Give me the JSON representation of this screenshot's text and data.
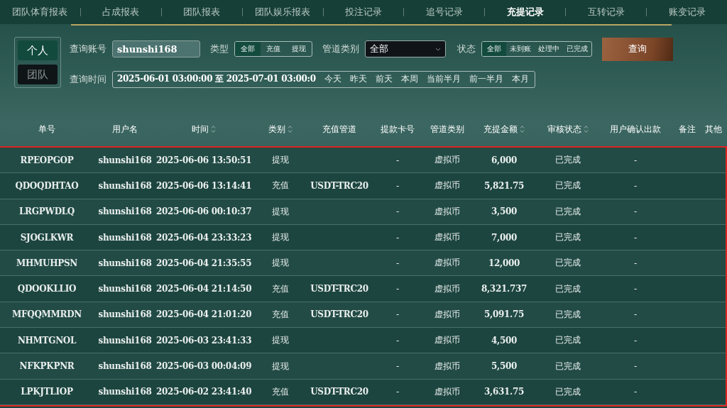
{
  "tabs": [
    {
      "label": "团队体育报表",
      "selected": false
    },
    {
      "label": "占成报表",
      "selected": false
    },
    {
      "label": "团队报表",
      "selected": false
    },
    {
      "label": "团队娱乐报表",
      "selected": false
    },
    {
      "label": "投注记录",
      "selected": false
    },
    {
      "label": "追号记录",
      "selected": false
    },
    {
      "label": "充提记录",
      "selected": true
    },
    {
      "label": "互转记录",
      "selected": false
    },
    {
      "label": "账变记录",
      "selected": false
    }
  ],
  "scope": [
    {
      "label": "个人",
      "selected": true
    },
    {
      "label": "团队",
      "selected": false
    }
  ],
  "filters": {
    "account_label": "查询账号",
    "account_value": "shunshi168",
    "type_label": "类型",
    "types": [
      {
        "label": "全部",
        "selected": true
      },
      {
        "label": "充值",
        "selected": false
      },
      {
        "label": "提现",
        "selected": false
      }
    ],
    "channel_label": "管道类别",
    "channel_value": "全部",
    "status_label": "状态",
    "statuses": [
      {
        "label": "全部",
        "selected": true
      },
      {
        "label": "未到账",
        "selected": false
      },
      {
        "label": "处理中",
        "selected": false
      },
      {
        "label": "已完成",
        "selected": false
      }
    ],
    "search_button": "查询",
    "time_label": "查询时间",
    "time_value": "2025-06-01 03:00:00 至 2025-07-01 03:00:0",
    "quick_dates": [
      "今天",
      "昨天",
      "前天",
      "本周",
      "当前半月",
      "前一半月",
      "本月"
    ]
  },
  "table": {
    "columns": [
      {
        "label": "单号",
        "sortable": false
      },
      {
        "label": "用户名",
        "sortable": false
      },
      {
        "label": "时间",
        "sortable": true
      },
      {
        "label": "类别",
        "sortable": true
      },
      {
        "label": "充值管道",
        "sortable": false
      },
      {
        "label": "提款卡号",
        "sortable": false
      },
      {
        "label": "管道类别",
        "sortable": false
      },
      {
        "label": "充提金额",
        "sortable": true
      },
      {
        "label": "审核状态",
        "sortable": true
      },
      {
        "label": "用户确认出款",
        "sortable": false
      },
      {
        "label": "备注",
        "sortable": false
      },
      {
        "label": "其他",
        "sortable": false
      }
    ],
    "rows": [
      {
        "cells": [
          "RPEOPGOP",
          "shunshi168",
          "2025-06-06 13:50:51",
          "提现",
          null,
          "-",
          "虚拟币",
          "6,000",
          "已完成",
          "-",
          null,
          null
        ]
      },
      {
        "cells": [
          "QDOQDHTAO",
          "shunshi168",
          "2025-06-06 13:14:41",
          "充值",
          "USDT-TRC20",
          "-",
          "虚拟币",
          "5,821.75",
          "已完成",
          "-",
          null,
          null
        ]
      },
      {
        "cells": [
          "LRGPWDLQ",
          "shunshi168",
          "2025-06-06 00:10:37",
          "提现",
          null,
          "-",
          "虚拟币",
          "3,500",
          "已完成",
          "-",
          null,
          null
        ]
      },
      {
        "cells": [
          "SJOGLKWR",
          "shunshi168",
          "2025-06-04 23:33:23",
          "提现",
          null,
          "-",
          "虚拟币",
          "7,000",
          "已完成",
          "-",
          null,
          null
        ]
      },
      {
        "cells": [
          "MHMUHPSN",
          "shunshi168",
          "2025-06-04 21:35:55",
          "提现",
          null,
          "-",
          "虚拟币",
          "12,000",
          "已完成",
          "-",
          null,
          null
        ]
      },
      {
        "cells": [
          "QDOOKLLIO",
          "shunshi168",
          "2025-06-04 21:14:50",
          "充值",
          "USDT-TRC20",
          "-",
          "虚拟币",
          "8,321.737",
          "已完成",
          "-",
          null,
          null
        ]
      },
      {
        "cells": [
          "MFQQMMRDN",
          "shunshi168",
          "2025-06-04 21:01:20",
          "充值",
          "USDT-TRC20",
          "-",
          "虚拟币",
          "5,091.75",
          "已完成",
          "-",
          null,
          null
        ]
      },
      {
        "cells": [
          "NHMTGNOL",
          "shunshi168",
          "2025-06-03 23:41:33",
          "提现",
          null,
          "-",
          "虚拟币",
          "4,500",
          "已完成",
          "-",
          null,
          null
        ]
      },
      {
        "cells": [
          "NFKPKPNR",
          "shunshi168",
          "2025-06-03 00:04:09",
          "提现",
          null,
          "-",
          "虚拟币",
          "5,500",
          "已完成",
          "-",
          null,
          null
        ]
      },
      {
        "cells": [
          "LPKJTLIOP",
          "shunshi168",
          "2025-06-02 23:41:40",
          "充值",
          "USDT-TRC20",
          "-",
          "虚拟币",
          "3,631.75",
          "已完成",
          "-",
          null,
          null
        ]
      }
    ]
  }
}
